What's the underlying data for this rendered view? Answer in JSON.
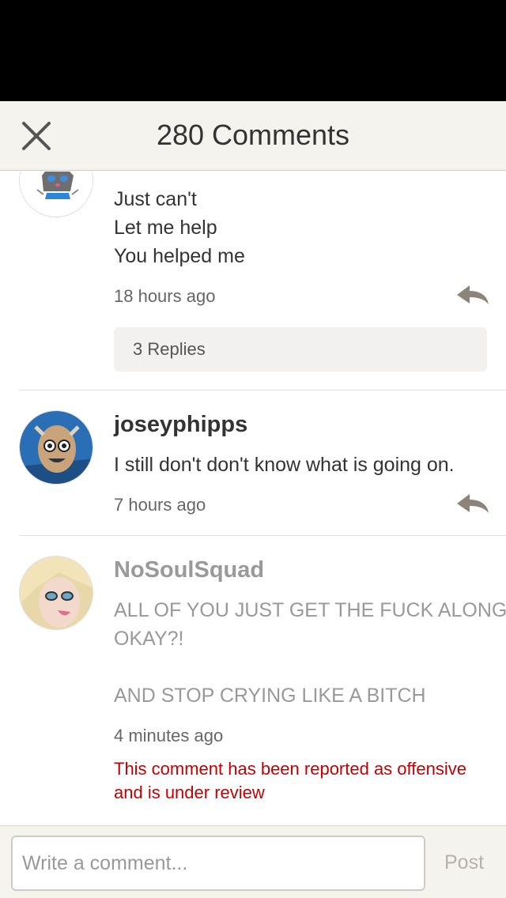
{
  "header": {
    "title": "280 Comments"
  },
  "comments": [
    {
      "lines": [
        "Just can't",
        "Let me help",
        "You helped me"
      ],
      "time": "18 hours ago",
      "replies_label": "3 Replies"
    },
    {
      "username": "joseyphipps",
      "lines": [
        "I still don't don't know what is going on."
      ],
      "time": "7 hours ago"
    },
    {
      "username": "NoSoulSquad",
      "lines": [
        "ALL OF YOU JUST GET THE FUCK ALONG",
        "OKAY?!",
        "AND STOP CRYING LIKE A BITCH"
      ],
      "time": "4 minutes ago",
      "report_notice": [
        "This comment has been reported as offensive",
        "and is under review"
      ]
    }
  ],
  "composer": {
    "placeholder": "Write a comment...",
    "post_label": "Post"
  },
  "icons": {
    "close": "close-icon",
    "reply": "reply-arrow-icon"
  },
  "colors": {
    "report_text": "#c40000",
    "header_bg": "#f5f3ee",
    "reply_icon": "#8c8379"
  }
}
